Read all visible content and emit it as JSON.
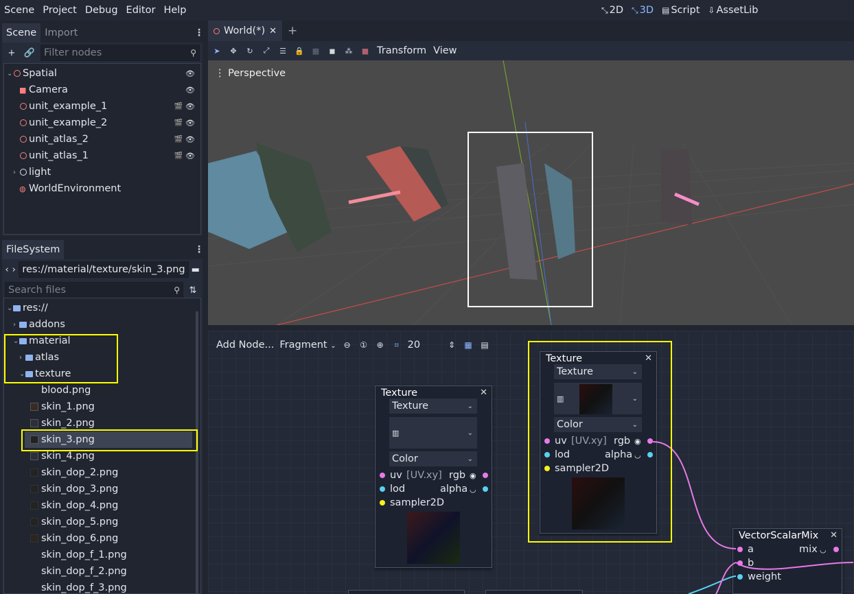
{
  "menu": [
    "Scene",
    "Project",
    "Debug",
    "Editor",
    "Help"
  ],
  "modes": {
    "m2d": "2D",
    "m3d": "3D",
    "script": "Script",
    "assetlib": "AssetLib"
  },
  "scene_dock": {
    "tab_scene": "Scene",
    "tab_import": "Import",
    "filter_placeholder": "Filter nodes",
    "nodes": [
      {
        "label": "Spatial"
      },
      {
        "label": "Camera"
      },
      {
        "label": "unit_example_1"
      },
      {
        "label": "unit_example_2"
      },
      {
        "label": "unit_atlas_2"
      },
      {
        "label": "unit_atlas_1"
      },
      {
        "label": "light"
      },
      {
        "label": "WorldEnvironment"
      }
    ]
  },
  "filesystem": {
    "tab": "FileSystem",
    "path": "res://material/texture/skin_3.png",
    "search_placeholder": "Search files",
    "items": [
      {
        "label": "res://"
      },
      {
        "label": "addons"
      },
      {
        "label": "material"
      },
      {
        "label": "atlas"
      },
      {
        "label": "texture"
      },
      {
        "label": "blood.png"
      },
      {
        "label": "skin_1.png"
      },
      {
        "label": "skin_2.png"
      },
      {
        "label": "skin_3.png"
      },
      {
        "label": "skin_4.png"
      },
      {
        "label": "skin_dop_2.png"
      },
      {
        "label": "skin_dop_3.png"
      },
      {
        "label": "skin_dop_4.png"
      },
      {
        "label": "skin_dop_5.png"
      },
      {
        "label": "skin_dop_6.png"
      },
      {
        "label": "skin_dop_f_1.png"
      },
      {
        "label": "skin_dop_f_2.png"
      },
      {
        "label": "skin_dop_f_3.png"
      }
    ]
  },
  "viewport": {
    "tab": "World(*)",
    "toolbar_transform": "Transform",
    "toolbar_view": "View",
    "perspective": "Perspective"
  },
  "shader_editor": {
    "add_node": "Add Node...",
    "mode": "Fragment",
    "zoom": "20",
    "node1": {
      "title": "Texture",
      "source": "Texture",
      "type": "Color",
      "uv": "uv",
      "uv_default": "[UV.xy]",
      "rgb": "rgb",
      "lod": "lod",
      "alpha": "alpha",
      "sampler": "sampler2D"
    },
    "node2": {
      "title": "Texture",
      "source": "Texture",
      "type": "Color",
      "uv": "uv",
      "uv_default": "[UV.xy]",
      "rgb": "rgb",
      "lod": "lod",
      "alpha": "alpha",
      "sampler": "sampler2D"
    },
    "node3": {
      "title": "VectorScalarMix",
      "a": "a",
      "b": "b",
      "weight": "weight",
      "mix": "mix"
    }
  },
  "colors": {
    "highlight": "#fffe02",
    "accent": "#8eb8ff",
    "port_vec": "#e67ae6",
    "port_scalar": "#5ad0f0",
    "port_sampler": "#f8f020"
  }
}
